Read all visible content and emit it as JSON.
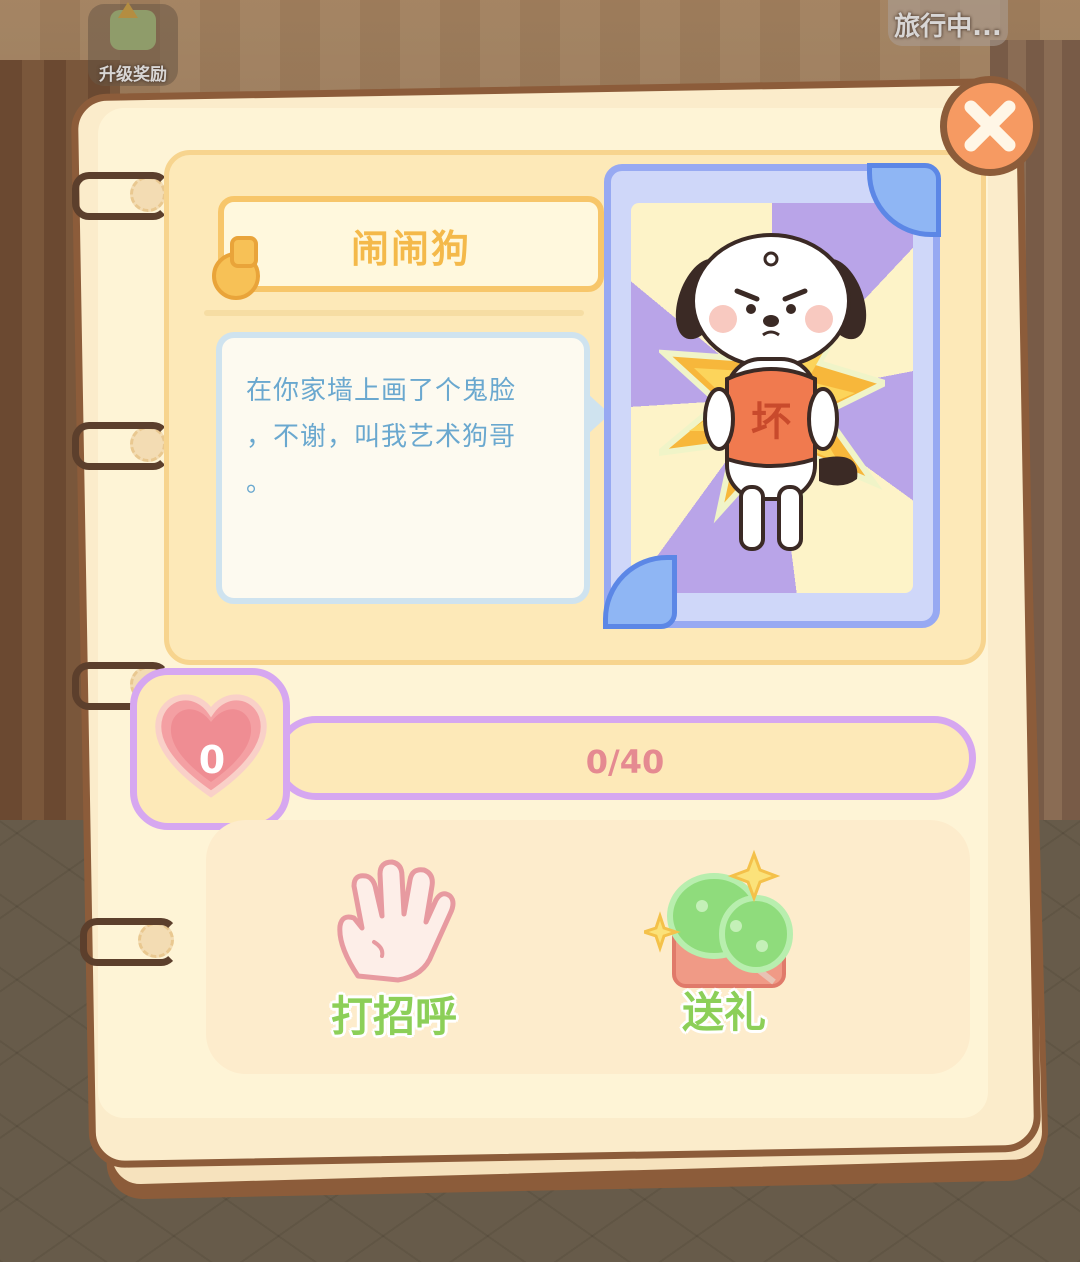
{
  "hud": {
    "upgrade_reward_label": "升级奖励",
    "travel_status_label": "旅行中..."
  },
  "character": {
    "name": "闹闹狗",
    "description_line1": "在你家墙上画了个鬼脸",
    "description_line2": "，不谢，叫我艺术狗哥",
    "description_line3": "。",
    "shirt_text": "坏"
  },
  "affection": {
    "level": "0",
    "progress_text": "0/40",
    "current": 0,
    "max": 40
  },
  "actions": {
    "greet_label": "打招呼",
    "gift_label": "送礼"
  },
  "icons": {
    "close": "close-icon",
    "heart": "heart-icon",
    "greet": "waving-hand-icon",
    "gift": "gift-box-icon",
    "upgrade": "upgrade-arrow-icon"
  },
  "colors": {
    "name_text": "#f4b94a",
    "description_text": "#6aa8cf",
    "progress_text": "#e58a91",
    "action_text": "#8ccf58",
    "bar_border": "#d6a7f0",
    "close_button": "#f69a62"
  }
}
